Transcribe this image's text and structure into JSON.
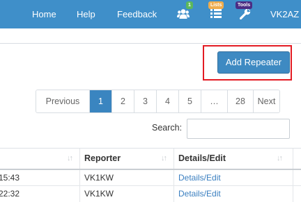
{
  "nav": {
    "home": "Home",
    "help": "Help",
    "feedback": "Feedback",
    "user": "VK2AZ",
    "icons": [
      {
        "name": "users-icon",
        "badge": "1",
        "badge_color": "#5cb85c"
      },
      {
        "name": "list-icon",
        "badge": "Lists",
        "badge_color": "#f0ad4e"
      },
      {
        "name": "wrench-icon",
        "badge": "Tools",
        "badge_color": "#4b2d84"
      }
    ],
    "bar_color": "#3f8fc9"
  },
  "actions": {
    "add_repeater": "Add Repeater",
    "highlight_color": "#e31b23"
  },
  "pagination": {
    "previous": "Previous",
    "pages": [
      "1",
      "2",
      "3",
      "4",
      "5"
    ],
    "gap": "…",
    "last": "28",
    "next": "Next",
    "active": "1"
  },
  "search": {
    "label": "Search:",
    "value": ""
  },
  "table": {
    "columns": [
      "",
      "Reporter",
      "Details/Edit"
    ],
    "rows": [
      {
        "time": "15:43",
        "reporter": "VK1KW",
        "details": "Details/Edit"
      },
      {
        "time": "22:32",
        "reporter": "VK1KW",
        "details": "Details/Edit"
      }
    ]
  }
}
